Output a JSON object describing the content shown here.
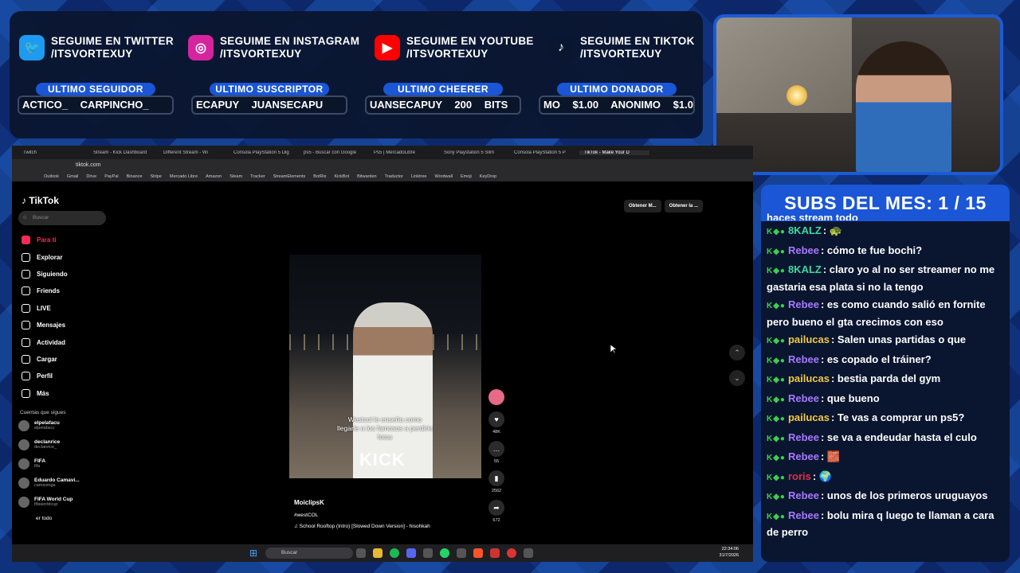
{
  "socials": [
    {
      "label": "SEGUIME EN TWITTER",
      "handle": "/ITSVORTEXUY",
      "icon": "twitter-icon",
      "color": "#1d9bf0",
      "glyph": "🐦"
    },
    {
      "label": "SEGUIME EN INSTAGRAM",
      "handle": "/ITSVORTEXUY",
      "icon": "instagram-icon",
      "color": "#d6249f",
      "glyph": "◎"
    },
    {
      "label": "SEGUIME EN YOUTUBE",
      "handle": "/ITSVORTEXUY",
      "icon": "youtube-icon",
      "color": "#ff0000",
      "glyph": "▶"
    },
    {
      "label": "SEGUIME EN TIKTOK",
      "handle": "/ITSVORTEXUY",
      "icon": "tiktok-icon",
      "color": "#0a1630",
      "glyph": "♪"
    }
  ],
  "stats": [
    {
      "label": "ULTIMO SEGUIDOR",
      "value": "ACTICO_ CARPINCHO_"
    },
    {
      "label": "ULTIMO SUSCRIPTOR",
      "value": "ECAPUY JUANSECAPU"
    },
    {
      "label": "ULTIMO CHEERER",
      "value": "UANSECAPUY 200 BITS"
    },
    {
      "label": "ULTIMO DONADOR",
      "value": "MO $1.00 ANONIMO $1.0"
    }
  ],
  "browser": {
    "tabs": [
      "Twitch",
      "Stream - Kick Dashboard",
      "Different Stream - Wi",
      "Consola PlayStation 5 Dig",
      "ps5 - Buscar con Google",
      "Ps5 | MercadoLibre",
      "Sony Playstation 5 Slim",
      "Consola PlayStation 5 P",
      "TikTok - Make Your D"
    ],
    "url": "tiktok.com",
    "bookmarks": [
      "Outlook",
      "Gmail",
      "Drive",
      "PayPal",
      "Binance",
      "Stripe",
      "Mercado Libre",
      "Amazon",
      "Steam",
      "Tracker",
      "StreamElements",
      "BotRix",
      "KickBot",
      "Bitwarden",
      "Traductor",
      "Linktree",
      "Wordwall",
      "Emoji",
      "KeyDrop"
    ]
  },
  "tiktok": {
    "logo": "TikTok",
    "search_placeholder": "Buscar",
    "nav": [
      "Para ti",
      "Explorar",
      "Siguiendo",
      "Friends",
      "LIVE",
      "Mensajes",
      "Actividad",
      "Cargar",
      "Perfil",
      "Más"
    ],
    "following_title": "Cuentas que sigues",
    "following": [
      {
        "name": "elpelafacu",
        "handle": "elpelafacu"
      },
      {
        "name": "declanrice",
        "handle": "declanrice_"
      },
      {
        "name": "FIFA",
        "handle": "fifa"
      },
      {
        "name": "Eduardo Camavi...",
        "handle": "camavinga"
      },
      {
        "name": "FIFA World Cup",
        "handle": "fifaworldcup"
      }
    ],
    "see_all": "er todo",
    "top_buttons": [
      "Obtener M...",
      "Obtener la ..."
    ],
    "video": {
      "caption": "Westcol le enseña como llegarle a los famosos a perdirle fotos",
      "overlay_brand": "KICK",
      "author": "MoiclipsK",
      "tags": "#westCOL",
      "music": "♫  School Rooftop (Intro) [Slowed Down Version] - hisohkah",
      "likes": "48K",
      "comments": "55",
      "saves": "2562",
      "shares": "672"
    }
  },
  "taskbar": {
    "search": "Buscar",
    "time": "22:34:06",
    "date": "31/7/2026"
  },
  "chat": {
    "title": "SUBS DEL MES: 1 / 15",
    "partial_top": "haces stream todo",
    "messages": [
      {
        "user": "8KALZ",
        "color": "#3fd8a0",
        "text": ": 🐢"
      },
      {
        "user": "Rebee",
        "color": "#a878ff",
        "text": ": cómo te fue bochi?"
      },
      {
        "user": "8KALZ",
        "color": "#3fd8a0",
        "text": ": claro yo al no ser streamer no me gastaria esa plata si no la tengo"
      },
      {
        "user": "Rebee",
        "color": "#a878ff",
        "text": ": es como cuando salió en fornite pero bueno el gta crecimos con eso"
      },
      {
        "user": "pailucas",
        "color": "#f2c842",
        "text": ": Salen unas partidas o que"
      },
      {
        "user": "Rebee",
        "color": "#a878ff",
        "text": ": es copado el tráiner?"
      },
      {
        "user": "pailucas",
        "color": "#f2c842",
        "text": ": bestia parda del gym"
      },
      {
        "user": "Rebee",
        "color": "#a878ff",
        "text": ": que bueno"
      },
      {
        "user": "pailucas",
        "color": "#f2c842",
        "text": ": Te vas a comprar un ps5?"
      },
      {
        "user": "Rebee",
        "color": "#a878ff",
        "text": ": se va a endeudar hasta el culo"
      },
      {
        "user": "Rebee",
        "color": "#a878ff",
        "text": ": 🧱"
      },
      {
        "user": "roris",
        "color": "#e0304a",
        "text": ": 🌍"
      },
      {
        "user": "Rebee",
        "color": "#a878ff",
        "text": ": unos de los primeros uruguayos"
      },
      {
        "user": "Rebee",
        "color": "#a878ff",
        "text": ": bolu mira q luego te llaman a cara de perro"
      }
    ]
  }
}
